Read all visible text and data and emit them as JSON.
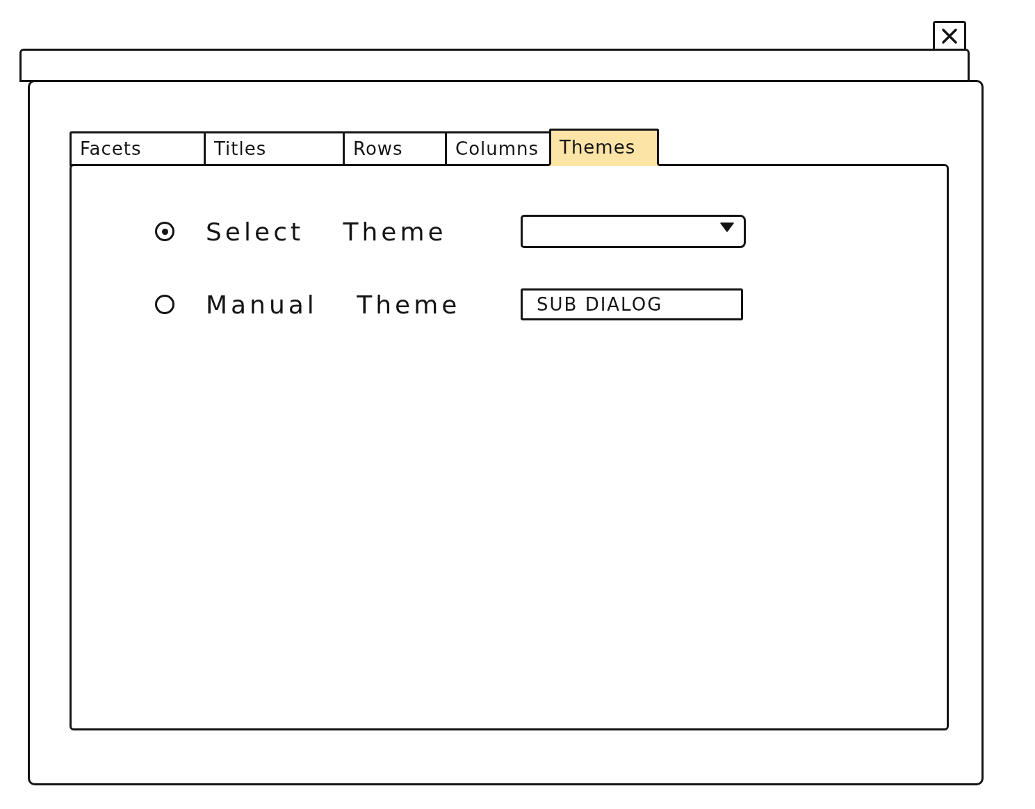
{
  "tabs": [
    {
      "label": "Facets",
      "selected": false
    },
    {
      "label": "Titles",
      "selected": false
    },
    {
      "label": "Rows",
      "selected": false
    },
    {
      "label": "Columns",
      "selected": false
    },
    {
      "label": "Themes",
      "selected": true
    }
  ],
  "options": [
    {
      "kind": "select",
      "label": "Select Theme",
      "selected": true
    },
    {
      "kind": "button",
      "label": "Manual Theme",
      "selected": false,
      "button_label": "SUB DIALOG"
    }
  ]
}
